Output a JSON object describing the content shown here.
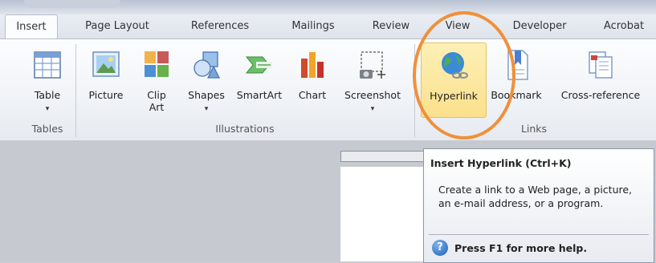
{
  "tabs": [
    "Insert",
    "Page Layout",
    "References",
    "Mailings",
    "Review",
    "View",
    "Developer",
    "Acrobat"
  ],
  "ribbon": {
    "groups": {
      "tables": "Tables",
      "illustrations": "Illustrations",
      "links": "Links"
    },
    "buttons": {
      "table": "Table",
      "picture": "Picture",
      "clipart_1": "Clip",
      "clipart_2": "Art",
      "shapes": "Shapes",
      "smartart": "SmartArt",
      "chart": "Chart",
      "screenshot": "Screenshot",
      "hyperlink": "Hyperlink",
      "bookmark": "Bookmark",
      "crossref": "Cross-reference"
    },
    "dropdown_glyph": "▾"
  },
  "tooltip": {
    "title": "Insert Hyperlink (Ctrl+K)",
    "description": "Create a link to a Web page, a picture, an e-mail address, or a program.",
    "help": "Press F1 for more help.",
    "help_glyph": "?"
  },
  "colors": {
    "highlight_ring": "#f0903a",
    "hover_button": "#fbe08c"
  }
}
